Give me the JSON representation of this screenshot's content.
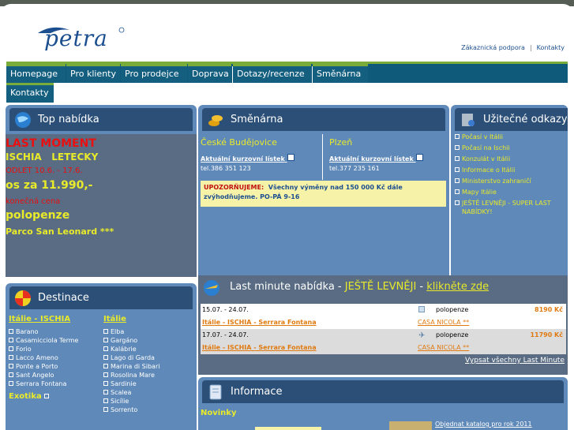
{
  "header": {
    "logo_text": "petra",
    "links": [
      "Zákaznická podpora",
      "Kontakty"
    ]
  },
  "nav": {
    "items": [
      "Homepage",
      "Pro klienty",
      "Pro prodejce",
      "Doprava",
      "Dotazy/recenze",
      "Směnárna"
    ],
    "row2": "Kontakty"
  },
  "top_offer": {
    "title": "Top nabídka",
    "line1": "LAST MOMENT",
    "line2": "ISCHIA   LETECKY",
    "line3": "ODLET 10.6. - 17.6.",
    "line4": "os za 11.990,-",
    "line5": "konečná cena",
    "line6": "polopenze",
    "line7": "Parco San Leonard ***"
  },
  "exchange": {
    "title": "Směnárna",
    "branches": [
      {
        "city": "České Budějovice",
        "link": "Aktuální kurzovní lístek",
        "phone": "tel.386 351 123"
      },
      {
        "city": "Plzeň",
        "link": "Aktuální kurzovní lístek",
        "phone": "tel.377 235 161"
      }
    ],
    "notice_label": "UPOZORŇUJEME:",
    "notice_text": "Všechny výměny nad 150 000 Kč dále zvýhodňujeme. PO-PÁ 9-16"
  },
  "useful": {
    "title": "Užitečné odkazy",
    "items": [
      "Počasí v Itálii",
      "Počasí na Ischii",
      "Konzulát v Itálii",
      "Informace o Itálii",
      "Ministerstvo zahraničí",
      "Mapy Itálie",
      "JEŠTĚ LEVNĚJI - SUPER LAST",
      "NABÍDKY!"
    ]
  },
  "destinations": {
    "title": "Destinace",
    "col1_head": "Itálie - ISCHIA",
    "col1": [
      "Barano",
      "Casamicciola Terme",
      "Forio",
      "Lacco Ameno",
      "Ponte a Porto",
      "Sant Angelo",
      "Serrara Fontana"
    ],
    "col1_extra": "Exotika",
    "col2_head": "Itálie",
    "col2": [
      "Elba",
      "Gargáno",
      "Kalábrie",
      "Lago di Garda",
      "Marina di Sibari",
      "Rosolina Mare",
      "Sardinie",
      "Scalea",
      "Sicílie",
      "Sorrento"
    ]
  },
  "lastminute": {
    "title_prefix": "Last minute nabídka - ",
    "title_hl": "JEŠTĚ LEVNĚJI",
    "title_sep": " - ",
    "title_link": "klikněte zde",
    "rows": [
      {
        "dates": "15.07. - 24.07.",
        "board": "polopenze",
        "price": "8190 Kč",
        "place": "Itálie - ISCHIA - Serrara Fontana",
        "hotel": "CASA NICOLA **"
      },
      {
        "dates": "17.07. - 24.07.",
        "board": "polopenze",
        "price": "11790 Kč",
        "place": "Itálie - ISCHIA - Serrara Fontana",
        "hotel": "CASA NICOLA **"
      }
    ],
    "all_link": "Vypsat všechny Last Minute"
  },
  "info": {
    "title": "Informace",
    "news": "Novinky",
    "catalog": "Objednat katalog pro rok 2011"
  },
  "colors": {
    "accent_green": "#7aac3a",
    "nav_blue": "#145f80",
    "panel_blue": "#5f89b8",
    "header_dark": "#2c4f78",
    "highlight_yellow": "#e8ea2a",
    "price_orange": "#e07a10"
  }
}
